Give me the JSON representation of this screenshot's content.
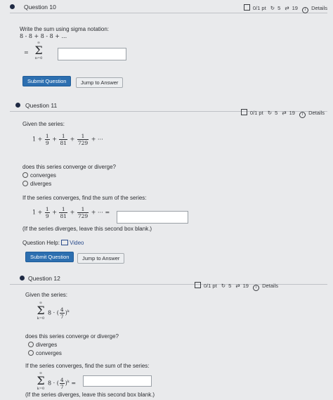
{
  "q10": {
    "title": "Question 10",
    "score": "0/1 pt",
    "retries": "5",
    "attempts": "19",
    "details": "Details",
    "prompt": "Write the sum using sigma notation:",
    "series": "8 - 8 + 8 - 8 + ...",
    "sigma_lead": "=",
    "sigma_upper": "∞",
    "sigma_lower": "n=0",
    "submit": "Submit Question",
    "jump": "Jump to Answer"
  },
  "q11": {
    "title": "Question 11",
    "score": "0/1 pt",
    "retries": "5",
    "attempts": "19",
    "details": "Details",
    "given": "Given the series:",
    "series_lead": "1 +",
    "f1_num": "1",
    "f1_den": "9",
    "f2_num": "1",
    "f2_den": "81",
    "f3_num": "1",
    "f3_den": "729",
    "plus": "+",
    "tail": "+ ⋯",
    "question": "does this series converge or diverge?",
    "options": [
      "converges",
      "diverges"
    ],
    "sum_prompt": "If the series converges, find the sum of the series:",
    "tail_eq": "+ ⋯ =",
    "diverge_note": "(If the series diverges, leave this second box blank.)",
    "help_label": "Question Help:",
    "video": "Video",
    "submit": "Submit Question",
    "jump": "Jump to Answer"
  },
  "q12": {
    "title": "Question 12",
    "score": "0/1 pt",
    "retries": "5",
    "attempts": "19",
    "details": "Details",
    "given": "Given the series:",
    "sigma_upper": "∞",
    "sigma_lower": "k=0",
    "term": "8 · (",
    "f_num": "4",
    "f_den": "7",
    "close": ")",
    "exp": "k",
    "question": "does this series converge or diverge?",
    "options": [
      "diverges",
      "converges"
    ],
    "sum_prompt": "If the series converges, find the sum of the series:",
    "eq": "=",
    "diverge_note": "(If the series diverges, leave this second box blank.)"
  }
}
